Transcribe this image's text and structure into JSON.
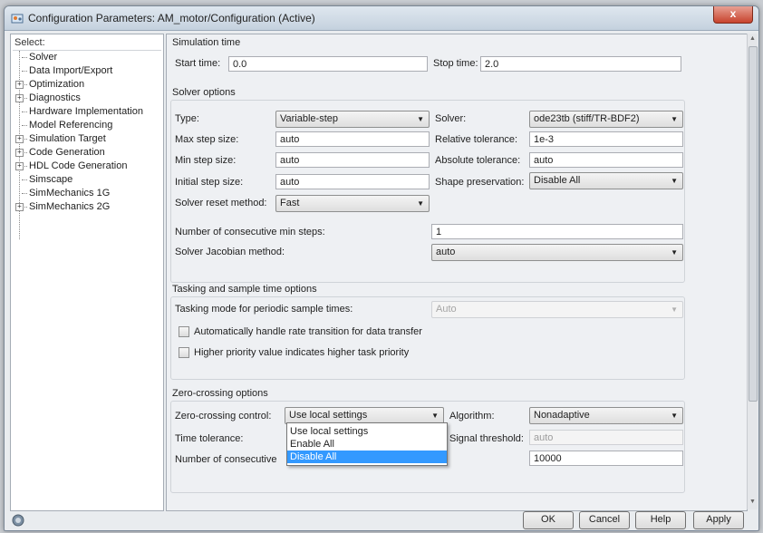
{
  "window": {
    "title": "Configuration Parameters: AM_motor/Configuration (Active)",
    "close_label": "x"
  },
  "tree": {
    "header": "Select:",
    "items": [
      {
        "label": "Solver",
        "expandable": false,
        "selected": true
      },
      {
        "label": "Data Import/Export",
        "expandable": false
      },
      {
        "label": "Optimization",
        "expandable": true
      },
      {
        "label": "Diagnostics",
        "expandable": true
      },
      {
        "label": "Hardware Implementation",
        "expandable": false
      },
      {
        "label": "Model Referencing",
        "expandable": false
      },
      {
        "label": "Simulation Target",
        "expandable": true
      },
      {
        "label": "Code Generation",
        "expandable": true
      },
      {
        "label": "HDL Code Generation",
        "expandable": true
      },
      {
        "label": "Simscape",
        "expandable": false
      },
      {
        "label": "SimMechanics 1G",
        "expandable": false
      },
      {
        "label": "SimMechanics 2G",
        "expandable": true
      }
    ]
  },
  "sim_time": {
    "title": "Simulation time",
    "start_label": "Start time:",
    "start_value": "0.0",
    "stop_label": "Stop time:",
    "stop_value": "2.0"
  },
  "solver": {
    "title": "Solver options",
    "type_label": "Type:",
    "type_value": "Variable-step",
    "solver_label": "Solver:",
    "solver_value": "ode23tb (stiff/TR-BDF2)",
    "max_step_label": "Max step size:",
    "max_step_value": "auto",
    "rel_tol_label": "Relative tolerance:",
    "rel_tol_value": "1e-3",
    "min_step_label": "Min step size:",
    "min_step_value": "auto",
    "abs_tol_label": "Absolute tolerance:",
    "abs_tol_value": "auto",
    "init_step_label": "Initial step size:",
    "init_step_value": "auto",
    "shape_label": "Shape preservation:",
    "shape_value": "Disable All",
    "reset_label": "Solver reset method:",
    "reset_value": "Fast",
    "consec_min_label": "Number of consecutive min steps:",
    "consec_min_value": "1",
    "jacobian_label": "Solver Jacobian method:",
    "jacobian_value": "auto"
  },
  "tasking": {
    "title": "Tasking and sample time options",
    "mode_label": "Tasking mode for periodic sample times:",
    "mode_value": "Auto",
    "auto_rate_label": "Automatically handle rate transition for data transfer",
    "higher_priority_label": "Higher priority value indicates higher task priority"
  },
  "zero_crossing": {
    "title": "Zero-crossing options",
    "control_label": "Zero-crossing control:",
    "control_value": "Use local settings",
    "algorithm_label": "Algorithm:",
    "algorithm_value": "Nonadaptive",
    "time_tol_label": "Time tolerance:",
    "signal_label": "Signal threshold:",
    "signal_value": "auto",
    "consec_label": "Number of consecutive",
    "consec_value": "10000",
    "options": [
      "Use local settings",
      "Enable All",
      "Disable All"
    ]
  },
  "buttons": {
    "ok": "OK",
    "cancel": "Cancel",
    "help": "Help",
    "apply": "Apply"
  }
}
